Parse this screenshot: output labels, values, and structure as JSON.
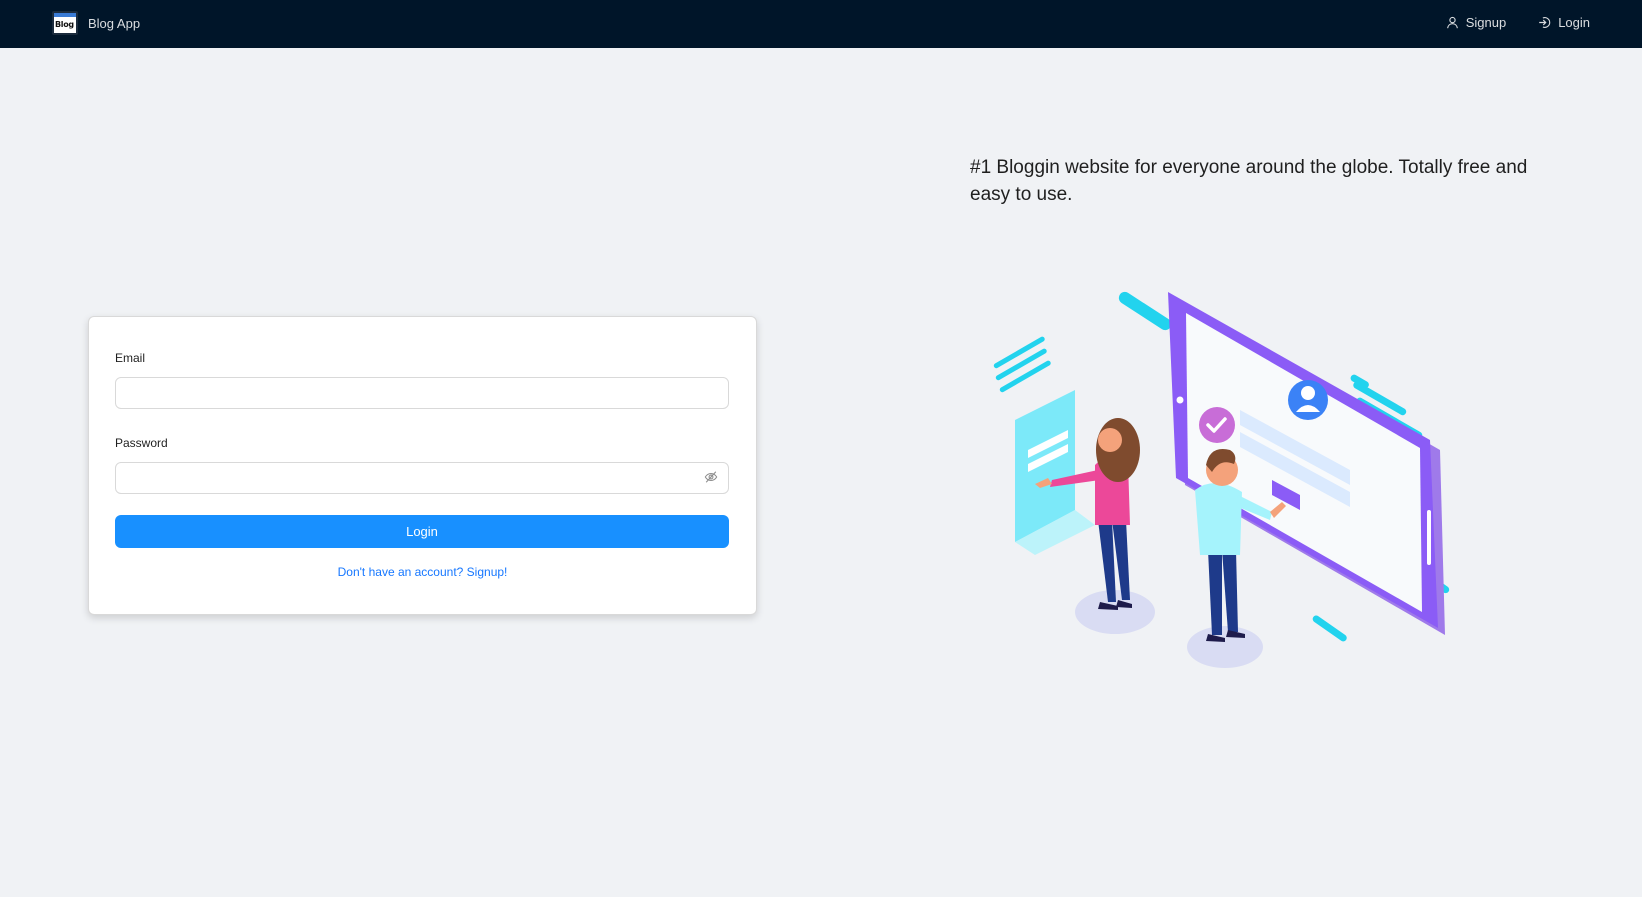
{
  "navbar": {
    "brand_logo_text": "Blog",
    "brand_name": "Blog App",
    "signup_label": "Signup",
    "login_label": "Login"
  },
  "login_form": {
    "email_label": "Email",
    "email_value": "",
    "password_label": "Password",
    "password_value": "",
    "submit_label": "Login",
    "signup_link": "Don't have an account? Signup!"
  },
  "hero": {
    "tagline": "#1 Bloggin website for everyone around the globe. Totally free and easy to use."
  },
  "colors": {
    "navbar_bg": "#001529",
    "page_bg": "#f0f2f5",
    "primary": "#1890ff",
    "link": "#1677ff"
  },
  "icons": {
    "signup": "user-icon",
    "login": "login-arrow-icon",
    "password_toggle": "eye-invisible-icon"
  }
}
